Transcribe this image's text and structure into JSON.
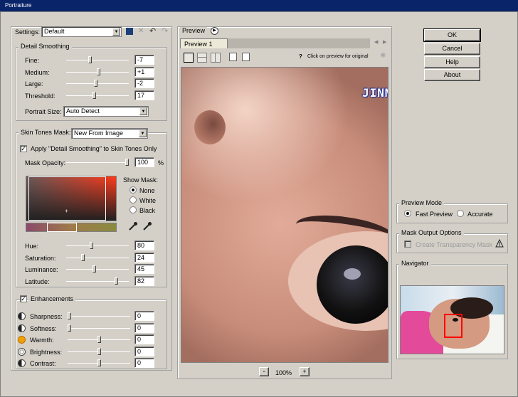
{
  "window": {
    "title": "Portraiture"
  },
  "settings": {
    "label": "Settings:",
    "value": "Default"
  },
  "detail_smoothing": {
    "title": "Detail Smoothing",
    "rows": [
      {
        "label": "Fine:",
        "value": "-7",
        "level": 0.37
      },
      {
        "label": "Medium:",
        "value": "+1",
        "level": 0.52
      },
      {
        "label": "Large:",
        "value": "-2",
        "level": 0.47
      },
      {
        "label": "Threshold:",
        "value": "17",
        "level": 0.45
      }
    ],
    "portrait_size": {
      "label": "Portrait Size:",
      "value": "Auto Detect"
    }
  },
  "skin_tones": {
    "mask_label": "Skin Tones Mask:",
    "mask_value": "New From Image",
    "apply_label": "Apply \"Detail Smoothing\" to Skin Tones Only",
    "apply_checked": "✓",
    "opacity_label": "Mask Opacity:",
    "opacity_value": "100",
    "opacity_unit": "%",
    "show_mask_label": "Show Mask:",
    "show_mask_options": [
      "None",
      "White",
      "Black"
    ],
    "rows": [
      {
        "label": "Hue:",
        "value": "80",
        "level": 0.4
      },
      {
        "label": "Saturation:",
        "value": "24",
        "level": 0.25
      },
      {
        "label": "Luminance:",
        "value": "45",
        "level": 0.45
      },
      {
        "label": "Latitude:",
        "value": "82",
        "level": 0.82
      }
    ]
  },
  "enhancements": {
    "title": "Enhancements",
    "checked": "✓",
    "rows": [
      {
        "label": "Sharpness:",
        "value": "0",
        "icon": "sharpness-icon",
        "level": 0.0
      },
      {
        "label": "Softness:",
        "value": "0",
        "icon": "softness-icon",
        "level": 0.0
      },
      {
        "label": "Warmth:",
        "value": "0",
        "icon": "warmth-icon",
        "level": 0.5
      },
      {
        "label": "Brightness:",
        "value": "0",
        "icon": "brightness-icon",
        "level": 0.5
      },
      {
        "label": "Contrast:",
        "value": "0",
        "icon": "contrast-icon",
        "level": 0.5
      }
    ]
  },
  "preview": {
    "label": "Preview",
    "tab": "Preview 1",
    "hint": "Click on preview for original",
    "watermark": "JINMODA.TISTORY.COM",
    "zoom": "100%",
    "zoom_minus": "-",
    "zoom_plus": "+"
  },
  "buttons": {
    "ok": "OK",
    "cancel": "Cancel",
    "help": "Help",
    "about": "About"
  },
  "preview_mode": {
    "title": "Preview Mode",
    "fast": "Fast Preview",
    "accurate": "Accurate"
  },
  "mask_output": {
    "title": "Mask Output Options",
    "create": "Create Transparency Mask"
  },
  "navigator": {
    "title": "Navigator"
  },
  "colors": {
    "titlebar": "#0a246a",
    "dialog": "#d4d0c8",
    "nav_box": "#ff0000",
    "watermark": "#ffffff"
  }
}
